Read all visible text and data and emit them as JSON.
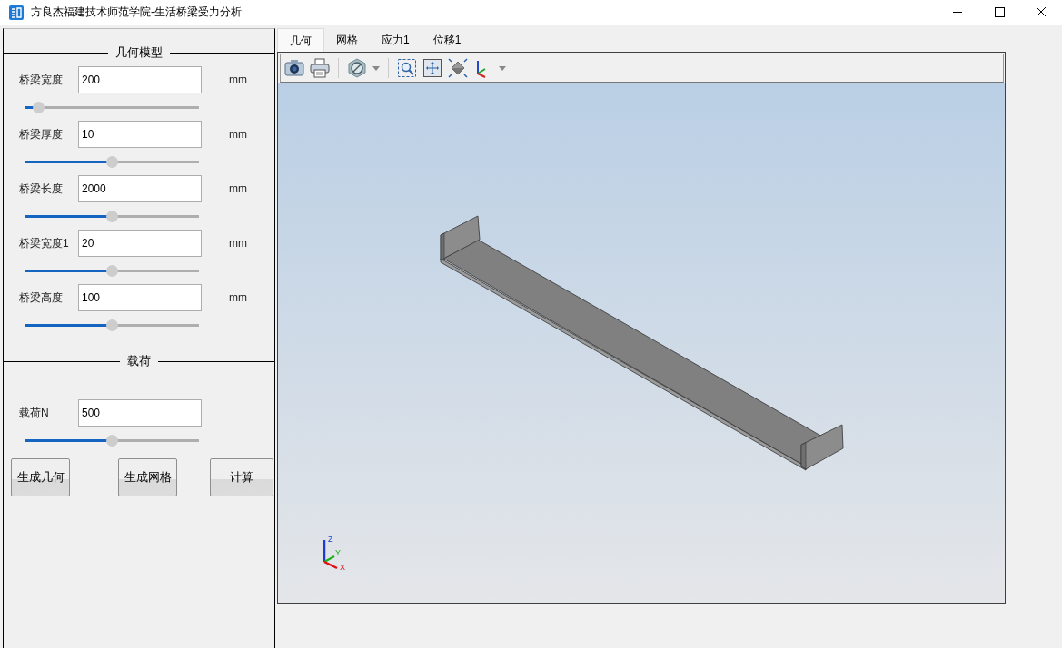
{
  "window": {
    "title": "方良杰福建技术师范学院-生活桥梁受力分析"
  },
  "geometry_section": {
    "title": "几何模型",
    "params": [
      {
        "label": "桥梁宽度",
        "value": "200",
        "unit": "mm",
        "level": 0.08
      },
      {
        "label": "桥梁厚度",
        "value": "10",
        "unit": "mm",
        "level": 0.5
      },
      {
        "label": "桥梁长度",
        "value": "2000",
        "unit": "mm",
        "level": 0.5
      },
      {
        "label": "桥梁宽度1",
        "value": "20",
        "unit": "mm",
        "level": 0.5
      },
      {
        "label": "桥梁高度",
        "value": "100",
        "unit": "mm",
        "level": 0.5
      }
    ]
  },
  "load_section": {
    "title": "载荷",
    "params": [
      {
        "label": "载荷N",
        "value": "500",
        "level": 0.5
      }
    ]
  },
  "buttons": [
    "生成几何",
    "生成网格",
    "计算"
  ],
  "tabs": [
    {
      "label": "几何",
      "selected": true
    },
    {
      "label": "网格",
      "selected": false
    },
    {
      "label": "应力1",
      "selected": false
    },
    {
      "label": "位移1",
      "selected": false
    }
  ],
  "axis_triad": {
    "labels": [
      "Z",
      "Y",
      "X"
    ]
  }
}
